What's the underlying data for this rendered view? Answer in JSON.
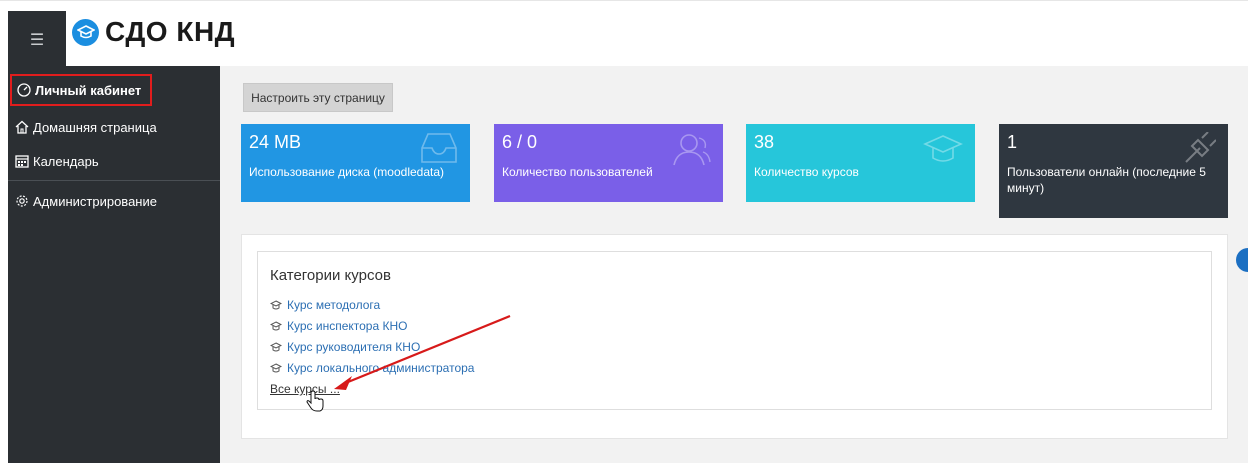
{
  "header": {
    "menu_icon": "hamburger-icon",
    "logo_icon": "graduation-cap-icon",
    "logo_text": "СДО КНД"
  },
  "sidebar": {
    "items": [
      {
        "label": "Личный кабинет",
        "icon": "dashboard-gauge-icon",
        "active": true
      },
      {
        "label": "Домашняя страница",
        "icon": "home-icon",
        "active": false
      },
      {
        "label": "Календарь",
        "icon": "calendar-icon",
        "active": false
      },
      {
        "label": "Администрирование",
        "icon": "gear-icon",
        "active": false
      }
    ]
  },
  "main": {
    "customize_button": "Настроить эту страницу",
    "tiles": [
      {
        "value": "24 MB",
        "label": "Использование диска (moodledata)",
        "color": "#2196e3",
        "icon": "inbox-tray-icon"
      },
      {
        "value": "6 / 0",
        "label": "Количество пользователей",
        "color": "#7a5fe8",
        "icon": "users-icon"
      },
      {
        "value": "38",
        "label": "Количество курсов",
        "color": "#26c6da",
        "icon": "graduation-cap-icon"
      },
      {
        "value": "1",
        "label": "Пользователи онлайн (последние 5 минут)",
        "color": "#2f3740",
        "icon": "plug-icon"
      }
    ],
    "categories_block": {
      "title": "Категории курсов",
      "items": [
        "Курс методолога",
        "Курс инспектора КНО",
        "Курс руководителя КНО",
        "Курс локального администратора"
      ],
      "all_courses": "Все курсы ..."
    }
  },
  "colors": {
    "sidebar_bg": "#2b2f33",
    "link": "#2c6fb3",
    "highlight": "#e11d1d",
    "annotation_arrow": "#d71a1a"
  }
}
